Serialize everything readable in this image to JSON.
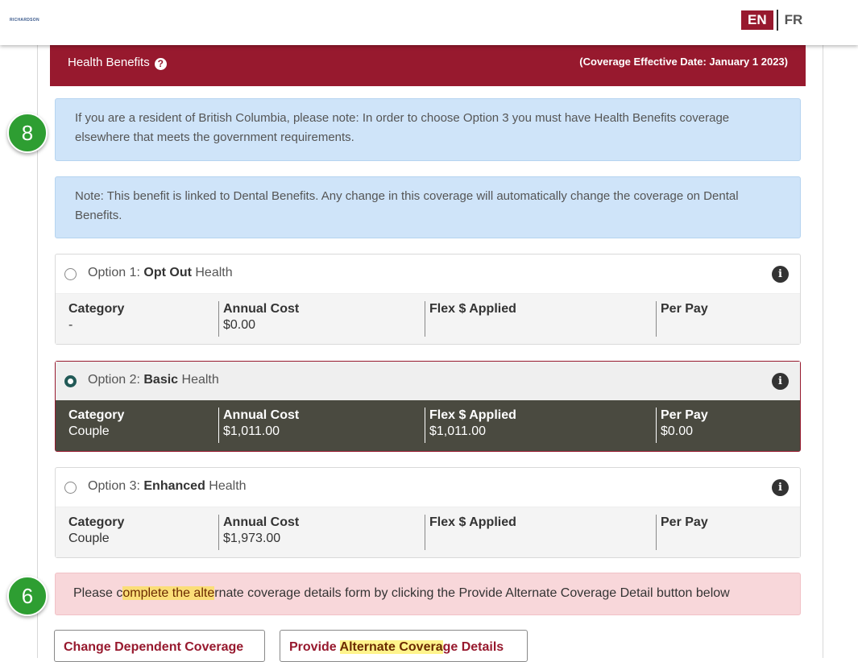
{
  "topbar": {
    "logo": "RICHARDSON",
    "lang_en": "EN",
    "lang_fr": "FR"
  },
  "header": {
    "title": "Health Benefits",
    "help": "?",
    "date_prefix": "(Coverage Effective Date: ",
    "date_value": "January 1 2023",
    "date_suffix": ")"
  },
  "notes": [
    "If you are a resident of British Columbia, please note: In order to choose Option 3 you must have Health Benefits coverage elsewhere that meets the government requirements.",
    "Note: This benefit is linked to Dental Benefits. Any change in this coverage will automatically change the coverage on Dental Benefits."
  ],
  "columns": {
    "category": "Category",
    "annual_cost": "Annual Cost",
    "flex_applied": "Flex $ Applied",
    "per_pay": "Per Pay"
  },
  "options": [
    {
      "prefix": "Option 1: ",
      "bold": "Opt Out",
      "suffix": " Health",
      "selected": false,
      "category": "-",
      "annual_cost": "$0.00",
      "flex_applied": "",
      "per_pay": ""
    },
    {
      "prefix": "Option 2: ",
      "bold": "Basic",
      "suffix": " Health",
      "selected": true,
      "category": "Couple",
      "annual_cost": "$1,011.00",
      "flex_applied": "$1,011.00",
      "per_pay": "$0.00"
    },
    {
      "prefix": "Option 3: ",
      "bold": "Enhanced",
      "suffix": " Health",
      "selected": false,
      "category": "Couple",
      "annual_cost": "$1,973.00",
      "flex_applied": "",
      "per_pay": ""
    }
  ],
  "alert": {
    "part1": "Please c",
    "hl": "omplete the alte",
    "part2": "rnate coverage details form by clicking the Provide Alternate Coverage Detail button below"
  },
  "buttons": {
    "change_dependent": "Change Dependent Coverage",
    "alt_prefix": "Provide ",
    "alt_hl": "Alternate Covera",
    "alt_suffix": "ge Details"
  },
  "steps": {
    "first": "8",
    "second": "6"
  },
  "colors": {
    "brand": "#97192e",
    "note_bg": "#cfe4f9",
    "alert_bg": "#f8d7da",
    "step_badge": "#2e9e32",
    "selected_row": "#4a4a40"
  }
}
